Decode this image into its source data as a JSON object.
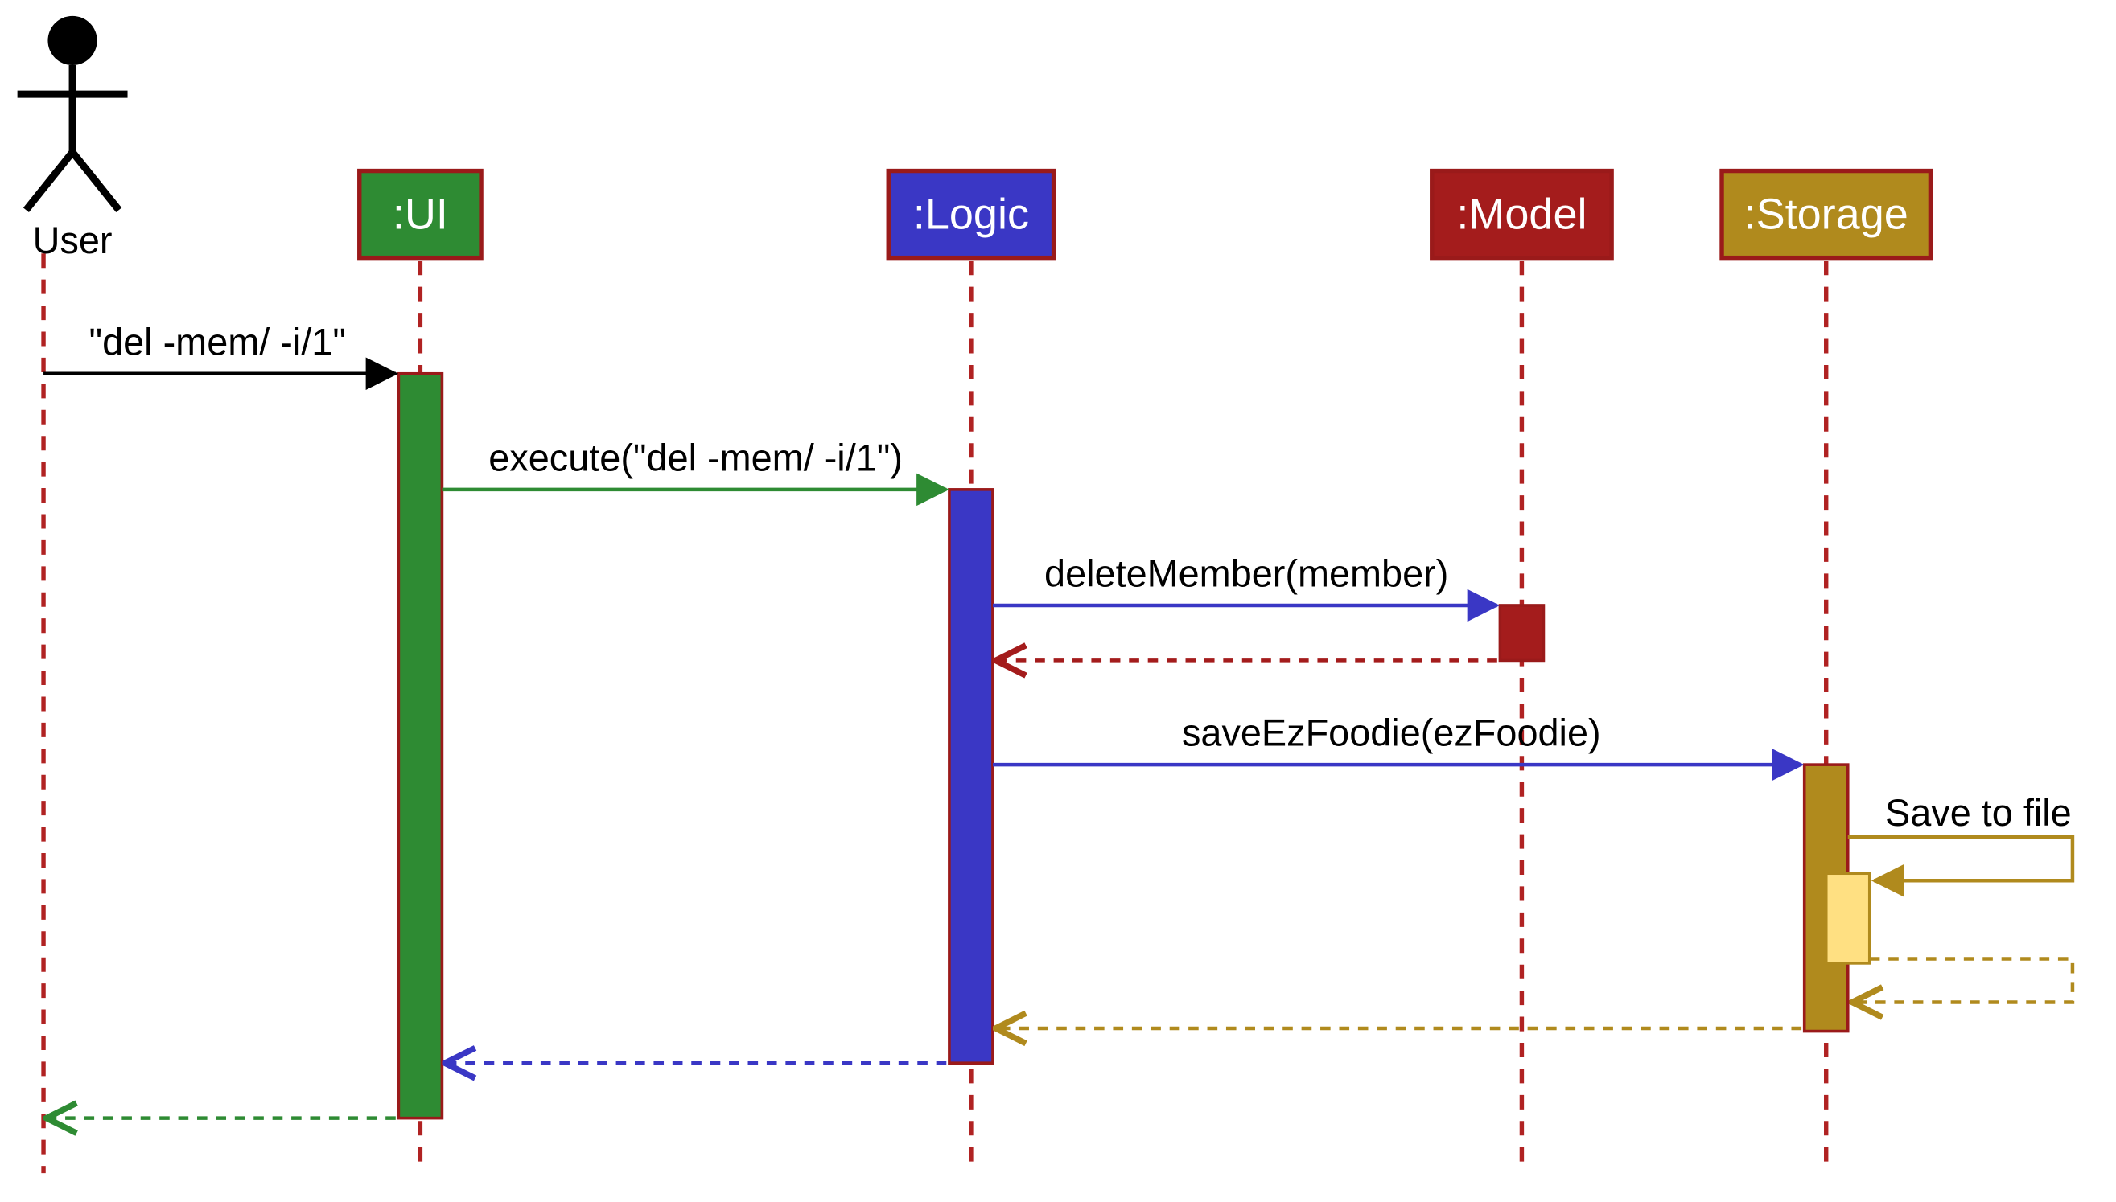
{
  "actors": {
    "user": "User",
    "ui": ":UI",
    "logic": ":Logic",
    "model": ":Model",
    "storage": ":Storage"
  },
  "messages": {
    "m1": "\"del -mem/ -i/1\"",
    "m2": "execute(\"del -mem/ -i/1\")",
    "m3": "deleteMember(member)",
    "m4": "saveEzFoodie(ezFoodie)",
    "m5": "Save to file"
  },
  "colors": {
    "user": "#000000",
    "ui": "#2e8b33",
    "logic": "#3a37c5",
    "model": "#a41c1c",
    "storage": "#b08a1d",
    "lifeline": "#b02222",
    "box_border": "#9a1a1a"
  },
  "diagram_type": "UML sequence diagram"
}
